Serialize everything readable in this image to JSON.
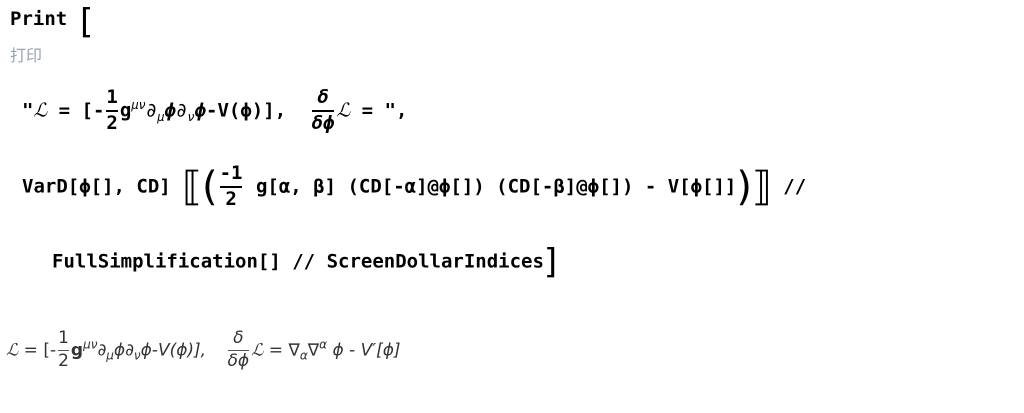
{
  "input": {
    "function_name": "Print",
    "autocomplete_hint": "打印",
    "string_literal": {
      "open_quote": "\"",
      "lagrangian": "ℒ",
      "equals": "=",
      "open_bracket": "[",
      "minus": "-",
      "half_num": "1",
      "half_den": "2",
      "metric": "g",
      "metric_sup": "μν",
      "partial_mu": "∂",
      "mu": "μ",
      "phi": "ϕ",
      "partial_nu": "∂",
      "nu": "ν",
      "potential": "-V(ϕ)",
      "close_bracket": "],",
      "delta_num": "δ",
      "delta_den": "δϕ",
      "lagrangian2": "ℒ",
      "equals2": "=",
      "close_quote": "\","
    },
    "line2": {
      "vard": "VarD[ϕ[], CD]",
      "neg_one": "-1",
      "two": "2",
      "g_term": "g[α, β] (CD[-α]@ϕ[]) (CD[-β]@ϕ[]) - V[ϕ[]]",
      "postfix": "//"
    },
    "line3": {
      "full_simplification": "FullSimplification[] //",
      "screen_dollar": "ScreenDollarIndices"
    }
  },
  "output": {
    "lagrangian": "ℒ",
    "equals": "=",
    "open_bracket": "[-",
    "half_num": "1",
    "half_den": "2",
    "metric": "g",
    "metric_sup": "μν",
    "partials": "∂",
    "mu": "μ",
    "phi": "ϕ",
    "nu": "ν",
    "potential": "ϕ-V(ϕ)],",
    "delta_num": "δ",
    "delta_den": "δϕ",
    "lagrangian2": "ℒ",
    "equals2": "=",
    "nabla": "∇",
    "alpha": "α",
    "rhs_tail": "ϕ - V′[ϕ]"
  }
}
